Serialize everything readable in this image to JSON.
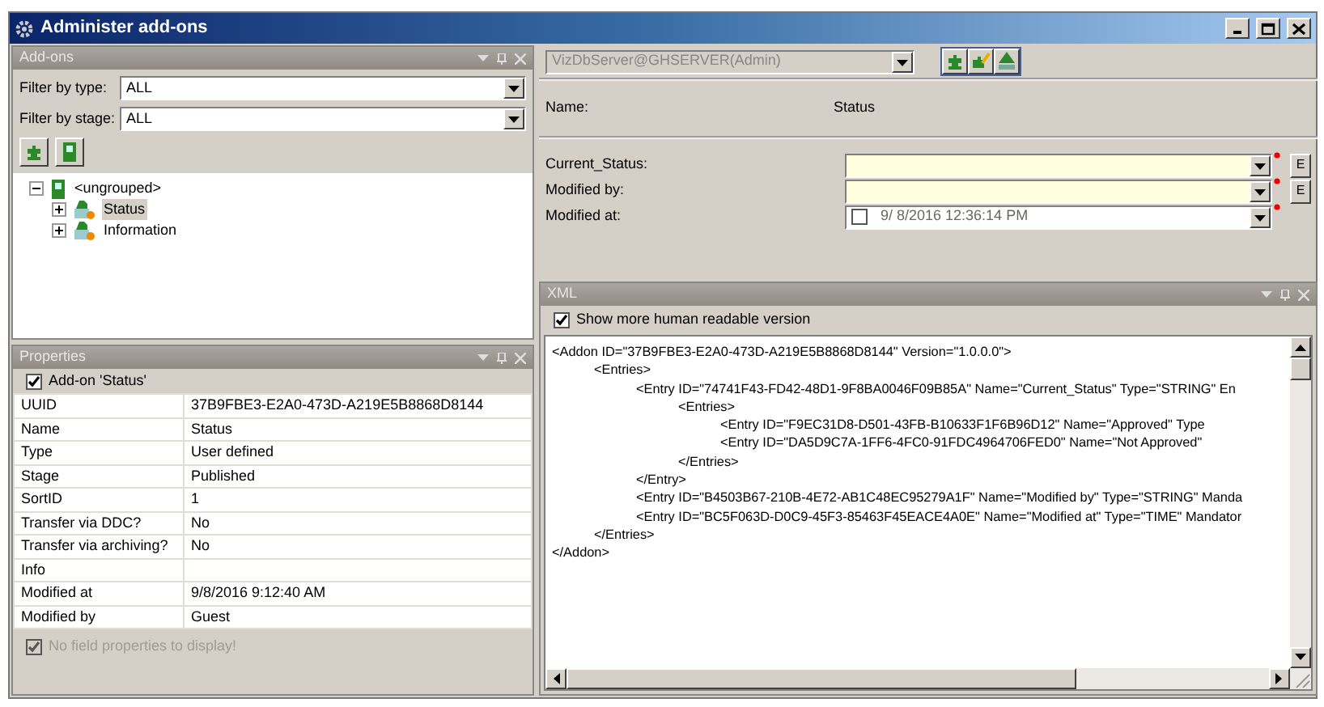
{
  "window": {
    "title": "Administer add-ons"
  },
  "addons_panel": {
    "title": "Add-ons",
    "filters": [
      {
        "label": "Filter by type:",
        "value": "ALL"
      },
      {
        "label": "Filter by stage:",
        "value": "ALL"
      }
    ],
    "tree": [
      {
        "label": "<ungrouped>",
        "expanded": true,
        "selected": false,
        "children": [
          {
            "label": "Status",
            "expanded": false,
            "selected": true
          },
          {
            "label": "Information",
            "expanded": false,
            "selected": false
          }
        ]
      }
    ]
  },
  "properties_panel": {
    "title": "Properties",
    "group": {
      "label": "Add-on 'Status'",
      "checked": true
    },
    "rows": [
      {
        "name": "UUID",
        "value": "37B9FBE3-E2A0-473D-A219E5B8868D8144"
      },
      {
        "name": "Name",
        "value": "Status"
      },
      {
        "name": "Type",
        "value": "User defined"
      },
      {
        "name": "Stage",
        "value": "Published"
      },
      {
        "name": "SortID",
        "value": "1"
      },
      {
        "name": "Transfer via DDC?",
        "value": "No"
      },
      {
        "name": "Transfer via archiving?",
        "value": "No"
      },
      {
        "name": "Info"
      },
      {
        "name": "Modified at",
        "value": "9/8/2016 9:12:40 AM"
      },
      {
        "name": "Modified by",
        "value": "Guest"
      }
    ],
    "footer": {
      "label": "No field properties to display!",
      "checked": true,
      "disabled": true
    }
  },
  "server_select": {
    "value": "VizDbServer@GHSERVER(Admin)",
    "disabled": true
  },
  "name_row": {
    "label": "Name:",
    "value": "Status"
  },
  "fields": [
    {
      "label": "Current_Status:",
      "kind": "combo",
      "required": true,
      "button": "E"
    },
    {
      "label": "Modified by:",
      "kind": "combo",
      "required": true,
      "button": "E"
    },
    {
      "label": "Modified at:",
      "kind": "datetime",
      "required": true,
      "checked": false,
      "value": "9/ 8/2016 12:36:14 PM"
    }
  ],
  "xml_panel": {
    "title": "XML",
    "option": {
      "label": "Show more human readable version",
      "checked": true
    },
    "lines": [
      {
        "open": "<Addon ID=\"37B9FBE3-E2A0-473D-A219E5B8868D8144\" Version=\"1.0.0.0\">",
        "close": "</Addon>",
        "children": [
          {
            "open": "<Entries>",
            "close": "</Entries>",
            "children": [
              {
                "open": "<Entry ID=\"74741F43-FD42-48D1-9F8BA0046F09B85A\" Name=\"Current_Status\" Type=\"STRING\" En",
                "close": "</Entry>",
                "children": [
                  {
                    "open": "<Entries>",
                    "close": "</Entries>",
                    "children": [
                      {
                        "open": "<Entry ID=\"F9EC31D8-D501-43FB-B10633F1F6B96D12\" Name=\"Approved\" Type"
                      },
                      {
                        "open": "<Entry ID=\"DA5D9C7A-1FF6-4FC0-91FDC4964706FED0\" Name=\"Not Approved\""
                      }
                    ]
                  }
                ]
              },
              {
                "open": "<Entry ID=\"B4503B67-210B-4E72-AB1C48EC95279A1F\" Name=\"Modified by\" Type=\"STRING\" Manda"
              },
              {
                "open": "<Entry ID=\"BC5F063D-D0C9-45F3-85463F45EACE4A0E\" Name=\"Modified at\" Type=\"TIME\" Mandator"
              }
            ]
          }
        ]
      }
    ]
  }
}
